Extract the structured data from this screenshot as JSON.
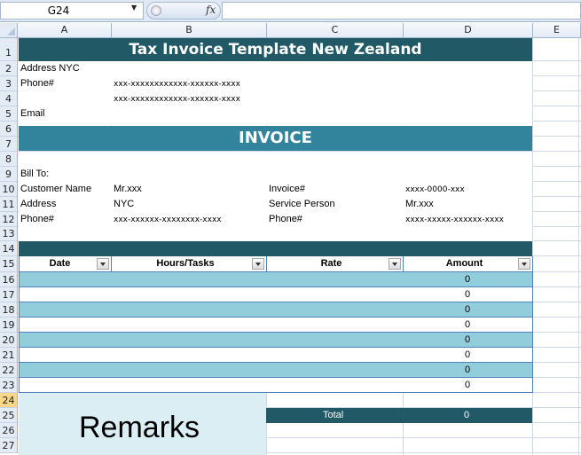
{
  "formula_bar": {
    "name_box": "G24",
    "fx_label": "fx",
    "formula_value": ""
  },
  "columns": [
    "A",
    "B",
    "C",
    "D",
    "E"
  ],
  "rows": [
    "1",
    "2",
    "3",
    "4",
    "5",
    "6",
    "7",
    "8",
    "9",
    "10",
    "11",
    "12",
    "13",
    "14",
    "15",
    "16",
    "17",
    "18",
    "19",
    "20",
    "21",
    "22",
    "23",
    "24",
    "25",
    "26",
    "27"
  ],
  "selected_row": "24",
  "sheet": {
    "title": "Tax Invoice Template New Zealand",
    "company": {
      "address": "Address NYC",
      "phone_label": "Phone#",
      "phone1": "xxx-xxxxxxxxxxxx-xxxxxx-xxxx",
      "phone2": "xxx-xxxxxxxxxxxx-xxxxxx-xxxx",
      "email_label": "Email"
    },
    "invoice_heading": "INVOICE",
    "bill_to": {
      "label": "Bill To:",
      "customer_name_label": "Customer Name",
      "customer_name": "Mr.xxx",
      "address_label": "Address",
      "address": "NYC",
      "phone_label": "Phone#",
      "phone": "xxx-xxxxxx-xxxxxxxx-xxxx",
      "invoice_no_label": "Invoice#",
      "invoice_no": "xxxx-0000-xxx",
      "service_person_label": "Service Person",
      "service_person": "Mr.xxx",
      "service_phone_label": "Phone#",
      "service_phone": "xxxx-xxxxx-xxxxxx-xxxx"
    },
    "table": {
      "headers": [
        "Date",
        "Hours/Tasks",
        "Rate",
        "Amount"
      ],
      "rows": [
        {
          "date": "",
          "task": "",
          "rate": "",
          "amount": "0"
        },
        {
          "date": "",
          "task": "",
          "rate": "",
          "amount": "0"
        },
        {
          "date": "",
          "task": "",
          "rate": "",
          "amount": "0"
        },
        {
          "date": "",
          "task": "",
          "rate": "",
          "amount": "0"
        },
        {
          "date": "",
          "task": "",
          "rate": "",
          "amount": "0"
        },
        {
          "date": "",
          "task": "",
          "rate": "",
          "amount": "0"
        },
        {
          "date": "",
          "task": "",
          "rate": "",
          "amount": "0"
        },
        {
          "date": "",
          "task": "",
          "rate": "",
          "amount": "0"
        }
      ]
    },
    "total_label": "Total",
    "total_value": "0",
    "remarks": "Remarks"
  },
  "colors": {
    "title_band": "#215967",
    "invoice_band": "#31849b",
    "row_stripe": "#92cddc",
    "remarks_bg": "#daeef3",
    "table_border": "#4f81bd"
  }
}
